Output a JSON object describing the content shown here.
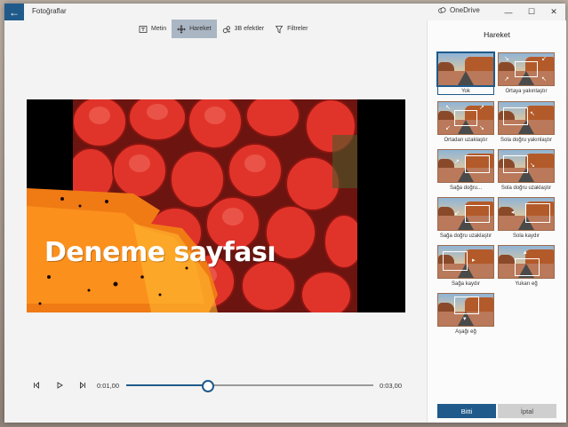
{
  "window": {
    "title": "Fotoğraflar",
    "onedrive_label": "OneDrive",
    "minimize": "—",
    "maximize": "☐",
    "close": "✕",
    "back": "←"
  },
  "toolbar": {
    "items": [
      {
        "label": "Metin",
        "icon": "text-icon",
        "active": false
      },
      {
        "label": "Hareket",
        "icon": "motion-icon",
        "active": true
      },
      {
        "label": "3B efektler",
        "icon": "3d-effects-icon",
        "active": false
      },
      {
        "label": "Filtreler",
        "icon": "filters-icon",
        "active": false
      }
    ]
  },
  "preview": {
    "caption": "Deneme sayfası"
  },
  "playback": {
    "current_time": "0:01,00",
    "total_time": "0:03,00",
    "progress": 0.33
  },
  "panel": {
    "title": "Hareket",
    "options": [
      {
        "label": "Yok",
        "selected": true
      },
      {
        "label": "Ortaya yakınlaştır",
        "selected": false
      },
      {
        "label": "Ortadan uzaklaştır",
        "selected": false
      },
      {
        "label": "Sola doğru yakınlaştır",
        "selected": false
      },
      {
        "label": "Sağa doğru...",
        "selected": false
      },
      {
        "label": "Sola doğru uzaklaştır",
        "selected": false
      },
      {
        "label": "Sağa doğru uzaklaştır",
        "selected": false
      },
      {
        "label": "Sola kaydır",
        "selected": false
      },
      {
        "label": "Sağa kaydır",
        "selected": false
      },
      {
        "label": "Yukarı eğ",
        "selected": false
      },
      {
        "label": "Aşağı eğ",
        "selected": false
      }
    ],
    "done_label": "Bitti",
    "cancel_label": "İptal"
  },
  "colors": {
    "accent": "#1f5a8a",
    "active_tool": "#aab6c3"
  }
}
